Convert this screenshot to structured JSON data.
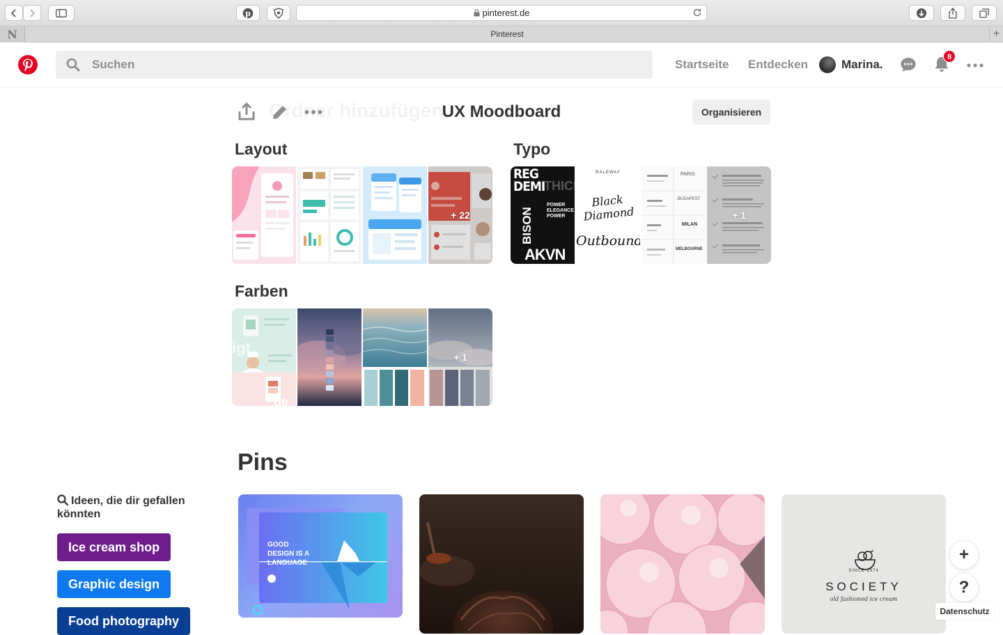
{
  "browser": {
    "url": "pinterest.de",
    "tab_title": "Pinterest",
    "tab_favicon_letter": "N"
  },
  "header": {
    "search_placeholder": "Suchen",
    "nav": {
      "home": "Startseite",
      "explore": "Entdecken"
    },
    "user_name": "Marina.",
    "notification_count": "8",
    "brand_color": "#e60023"
  },
  "board": {
    "title": "UX Moodboard",
    "add_section_ghost": "Ordner hinzufügen",
    "organize_label": "Organisieren",
    "sections": [
      {
        "title": "Layout",
        "more": "+ 22"
      },
      {
        "title": "Typo",
        "more": "+ 1"
      },
      {
        "title": "Farben",
        "more": "+ 1"
      }
    ]
  },
  "typo_samples": {
    "bison": "BISON",
    "reg": "REG",
    "demi": "DEMI",
    "thick": "THICK",
    "akvn": "AKVN",
    "power": "POWER",
    "elegance": "ELEGANCE",
    "raleway": "RALEWAY",
    "black_diamond": "Black Diamond",
    "outbound": "Outbound",
    "paris": "PARIS",
    "budapest": "BUDAPEST",
    "milan": "MILAN",
    "melbourne": "MELBOURNE"
  },
  "pins": {
    "title": "Pins",
    "items": [
      {
        "headline": "GOOD DESIGN IS A LANGUAGE"
      },
      {
        "headline": ""
      },
      {
        "headline": ""
      },
      {
        "brand": "SOCIETY",
        "since": "SINCE 1974",
        "tagline": "old fashioned ice cream"
      }
    ]
  },
  "ideas": {
    "heading": "Ideen, die dir gefallen könnten",
    "chips": [
      {
        "label": "Ice cream shop",
        "color": "#6e1e8c"
      },
      {
        "label": "Graphic design",
        "color": "#0f7af0"
      },
      {
        "label": "Food photography",
        "color": "#0b3f93"
      }
    ]
  },
  "floating": {
    "add": "+",
    "help": "?",
    "privacy": "Datenschutz"
  }
}
